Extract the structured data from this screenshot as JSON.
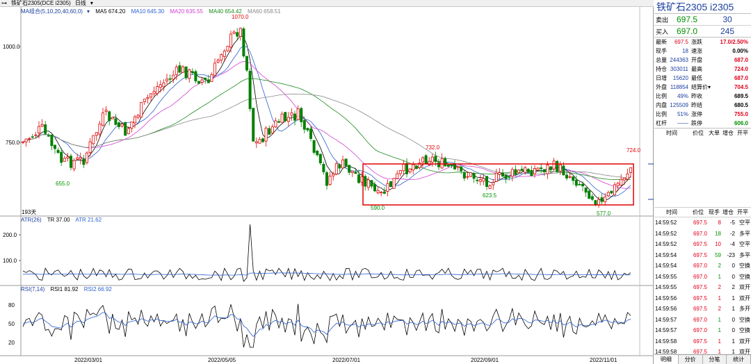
{
  "top_bar": {
    "icon": "chart-icon",
    "title": "铁矿石2305(DCE i2305)",
    "period": "日线",
    "dropdown": "▾"
  },
  "ma_legend": {
    "name": "MA组合(5,10,20,40,60,0)",
    "items": [
      {
        "label": "MA5 674.20",
        "color": "#000000"
      },
      {
        "label": "MA10 645.30",
        "color": "#2a5fd0"
      },
      {
        "label": "MA20 635.55",
        "color": "#d040d0"
      },
      {
        "label": "MA40 654.42",
        "color": "#1a8a1a"
      },
      {
        "label": "MA60 658.51",
        "color": "#888888"
      }
    ]
  },
  "atr_legend": {
    "name": "ATR(26)",
    "items": [
      {
        "label": "TR 37.00",
        "color": "#000000"
      },
      {
        "label": "ATR 21.62",
        "color": "#2a5fd0"
      }
    ]
  },
  "rsi_legend": {
    "name": "RSI(7,14)",
    "items": [
      {
        "label": "RSI1 81.92",
        "color": "#000000"
      },
      {
        "label": "RSI2 66.92",
        "color": "#2a5fd0"
      }
    ]
  },
  "annotations": {
    "high": "1070.0",
    "low1": "655.0",
    "low2": "590.0",
    "high2": "732.0",
    "low3": "623.5",
    "low4": "577.0",
    "last_high": "724.0",
    "days": "193天"
  },
  "axis": {
    "price_ticks": [
      "1000.0",
      "750.0"
    ],
    "atr_ticks": [
      "200.0",
      "100.0"
    ],
    "rsi_ticks": [
      "80",
      "50",
      "20"
    ],
    "dates": [
      "2022/03/01",
      "2022/05/05",
      "2022/07/01",
      "2022/09/01",
      "2022/11/01"
    ]
  },
  "right_panel": {
    "title": "铁矿石2305",
    "code": "i2305",
    "sell": {
      "label": "卖出",
      "price": "697.5",
      "qty": "30"
    },
    "buy": {
      "label": "买入",
      "price": "697.0",
      "qty": "245"
    },
    "stats": [
      {
        "k1": "最新",
        "v1": "697.5",
        "c1": "red",
        "k2": "涨跌",
        "v2": "17.0/2.50%",
        "c2": "red"
      },
      {
        "k1": "现手",
        "v1": "18",
        "c1": "blue",
        "k2": "速涨",
        "v2": "0.00%",
        "c2": "dark"
      },
      {
        "k1": "总量",
        "v1": "244363",
        "c1": "blue",
        "k2": "开盘",
        "v2": "687.0",
        "c2": "red"
      },
      {
        "k1": "持仓",
        "v1": "303011",
        "c1": "blue",
        "k2": "最高",
        "v2": "724.0",
        "c2": "red"
      },
      {
        "k1": "日增",
        "v1": "15620",
        "c1": "blue",
        "k2": "最低",
        "v2": "687.0",
        "c2": "red"
      },
      {
        "k1": "外盘",
        "v1": "118854",
        "c1": "blue",
        "k2": "结算价▾",
        "v2": "704.5",
        "c2": "red"
      },
      {
        "k1": "比例",
        "v1": "49%",
        "c1": "blue",
        "k2": "昨收",
        "v2": "689.5",
        "c2": "dark"
      },
      {
        "k1": "内盘",
        "v1": "125509",
        "c1": "blue",
        "k2": "昨结",
        "v2": "680.5",
        "c2": "dark"
      },
      {
        "k1": "比例",
        "v1": "51%",
        "c1": "blue",
        "k2": "涨停",
        "v2": "755.0",
        "c2": "red"
      },
      {
        "k1": "杠杆",
        "v1": "——",
        "c1": "blue",
        "k2": "跌停",
        "v2": "606.0",
        "c2": "green"
      }
    ],
    "section1_headers": [
      "时间",
      "价位",
      "大单",
      "增仓",
      "开平"
    ],
    "ticks_headers": [
      "时间",
      "价位",
      "现手",
      "增仓",
      "开平"
    ],
    "ticks": [
      {
        "time": "14:59:52",
        "price": "697.5",
        "vol": "8",
        "vc": "red",
        "chg": "-5",
        "type": "空平"
      },
      {
        "time": "14:59:52",
        "price": "697.0",
        "vol": "18",
        "vc": "green",
        "chg": "-2",
        "type": "多平"
      },
      {
        "time": "14:59:52",
        "price": "697.5",
        "vol": "10",
        "vc": "red",
        "chg": "-4",
        "type": "空平"
      },
      {
        "time": "14:59:54",
        "price": "697.5",
        "vol": "59",
        "vc": "green",
        "chg": "-23",
        "type": "多平"
      },
      {
        "time": "14:59:54",
        "price": "697.0",
        "vol": "2",
        "vc": "green",
        "chg": "0",
        "type": "空换"
      },
      {
        "time": "14:59:55",
        "price": "697.0",
        "vol": "1",
        "vc": "green",
        "chg": "0",
        "type": "空换"
      },
      {
        "time": "14:59:55",
        "price": "697.5",
        "vol": "2",
        "vc": "red",
        "chg": "2",
        "type": "双开"
      },
      {
        "time": "14:59:56",
        "price": "697.5",
        "vol": "1",
        "vc": "red",
        "chg": "1",
        "type": "双开"
      },
      {
        "time": "14:59:56",
        "price": "697.5",
        "vol": "2",
        "vc": "red",
        "chg": "1",
        "type": "多开"
      },
      {
        "time": "14:59:57",
        "price": "697.0",
        "vol": "1",
        "vc": "green",
        "chg": "0",
        "type": "空换"
      },
      {
        "time": "14:59:57",
        "price": "697.0",
        "vol": "1",
        "vc": "green",
        "chg": "0",
        "type": "空换"
      },
      {
        "time": "14:59:58",
        "price": "697.5",
        "vol": "1",
        "vc": "red",
        "chg": "1",
        "type": "双开"
      },
      {
        "time": "14:59:58",
        "price": "697.5",
        "vol": "1",
        "vc": "red",
        "chg": "1",
        "type": "双开"
      },
      {
        "time": "14:59:59",
        "price": "697.5",
        "vol": "18",
        "vc": "red",
        "chg": "10",
        "type": "多换"
      }
    ],
    "tabs": [
      "明细",
      "分价",
      "分笔",
      "统计"
    ]
  }
}
